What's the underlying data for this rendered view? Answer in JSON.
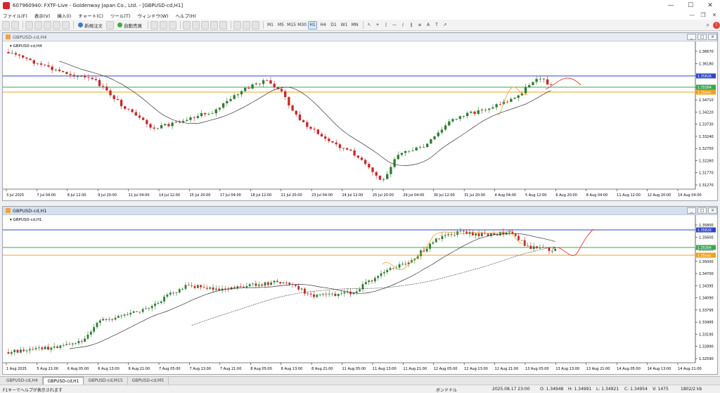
{
  "window": {
    "title": "607960940: FXTF-Live - Goldenway Japan Co., Ltd. - [GBPUSD-cd,H1]"
  },
  "menu": [
    "ファイル(F)",
    "表示(V)",
    "挿入(I)",
    "チャート(C)",
    "ツール(T)",
    "ウィンドウ(W)",
    "ヘルプ(H)"
  ],
  "toolbar": {
    "new_order": "新規注文",
    "auto_trade": "自動売買",
    "timeframes": [
      "M1",
      "M5",
      "M15",
      "M30",
      "H1",
      "H4",
      "D1",
      "W1",
      "MN"
    ],
    "active_timeframe": "H1"
  },
  "chart_top": {
    "window_title": "GBPUSD-cd,H4",
    "label": "GBPUSD-cd,H4",
    "price_ticks": [
      "1.36670",
      "1.36180",
      "1.35690",
      "1.35200",
      "1.34710",
      "1.34220",
      "1.33730",
      "1.33240",
      "1.32750",
      "1.32260",
      "1.31770",
      "1.31270"
    ],
    "price_tags": {
      "blue": "1.35826",
      "green": "1.35364",
      "orange": "1.35xxx"
    },
    "time_ticks": [
      "3 Jul 2025",
      "7 Jul 04:00",
      "8 Jul 12:00",
      "9 Jul 20:00",
      "11 Jul 04:00",
      "14 Jul 12:00",
      "15 Jul 20:00",
      "17 Jul 04:00",
      "18 Jul 12:00",
      "21 Jul 20:00",
      "23 Jul 04:00",
      "24 Jul 12:00",
      "25 Jul 20:00",
      "29 Jul 04:00",
      "30 Jul 12:00",
      "31 Jul 20:00",
      "4 Aug 04:00",
      "5 Aug 12:00",
      "6 Aug 20:00",
      "8 Aug 04:00",
      "11 Aug 12:00",
      "12 Aug 20:00",
      "14 Aug 04:00"
    ]
  },
  "chart_bottom": {
    "window_title": "GBPUSD-cd,H1",
    "label": "GBPUSD-cd,H1",
    "price_ticks": [
      "1.35800",
      "1.35600",
      "1.35390",
      "1.35000",
      "1.34700",
      "1.34395",
      "1.34090",
      "1.33795",
      "1.33495",
      "1.33195",
      "1.32890",
      "1.32590"
    ],
    "price_tags": {
      "blue": "1.35826",
      "green": "1.35364",
      "orange": "1.35xxx"
    },
    "time_ticks": [
      "1 Aug 2025",
      "5 Aug 21:00",
      "6 Aug 05:00",
      "6 Aug 13:00",
      "6 Aug 21:00",
      "7 Aug 05:00",
      "7 Aug 13:00",
      "7 Aug 21:00",
      "8 Aug 05:00",
      "8 Aug 13:00",
      "8 Aug 21:00",
      "11 Aug 05:00",
      "11 Aug 13:00",
      "11 Aug 21:00",
      "12 Aug 05:00",
      "12 Aug 13:00",
      "12 Aug 21:00",
      "13 Aug 05:00",
      "13 Aug 13:00",
      "13 Aug 21:00",
      "14 Aug 05:00",
      "14 Aug 13:00",
      "14 Aug 21:00"
    ]
  },
  "tabs": [
    {
      "label": "GBPUSD-cd,H4",
      "active": false
    },
    {
      "label": "GBPUSD-cd,H1",
      "active": true
    },
    {
      "label": "GBPUSD-cd,M15",
      "active": false
    },
    {
      "label": "GBPUSD-cd,M5",
      "active": false
    }
  ],
  "status": {
    "help": "F1キーでヘルプが表示されます",
    "template": "ボンドドル",
    "datetime": "2025.08.17 23:00",
    "open": "O: 1.34948",
    "high": "H: 1.34991",
    "low": "L: 1.34921",
    "close": "C: 1.34954",
    "volume": "V: 1475",
    "traffic": "1802/2 kb"
  },
  "colors": {
    "bull": "#2e7d32",
    "bear": "#c62828",
    "ma": "#333333",
    "line_blue": "#2f45c8",
    "line_green": "#3aa655",
    "line_orange": "#f0a020",
    "forecast": "#e53935"
  }
}
